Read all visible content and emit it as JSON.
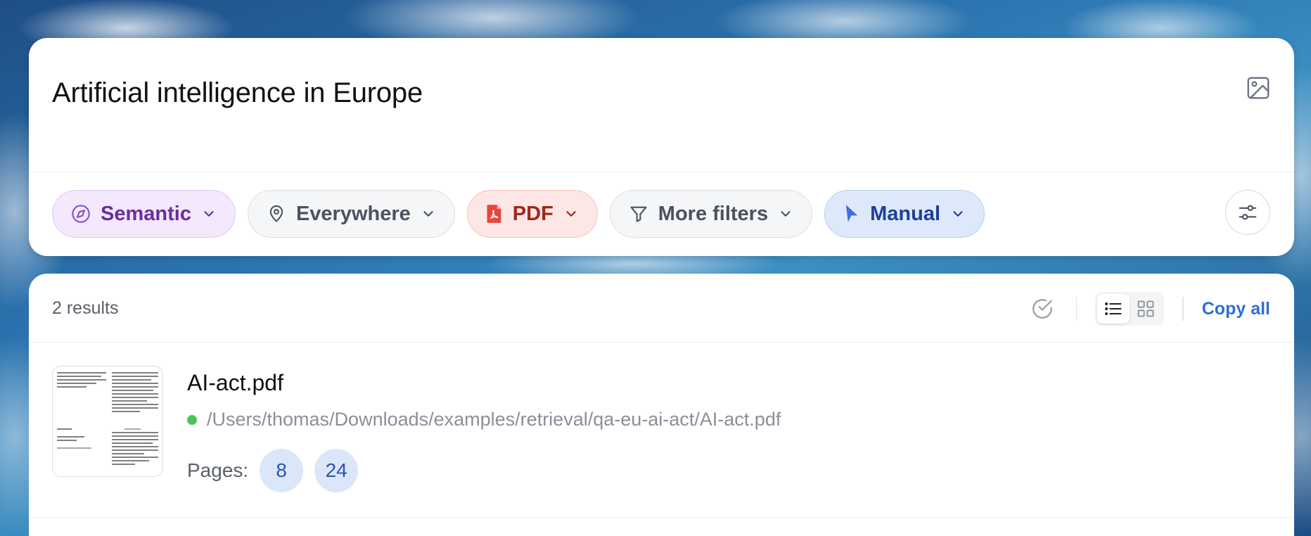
{
  "search": {
    "query": "Artificial intelligence in Europe",
    "image_button_icon": "image-icon"
  },
  "filters": {
    "semantic": {
      "label": "Semantic",
      "icon": "compass-icon",
      "color": "#6a2ca0"
    },
    "location": {
      "label": "Everywhere",
      "icon": "map-pin-icon",
      "color": "#4b5260"
    },
    "file_type": {
      "label": "PDF",
      "icon": "pdf-file-icon",
      "color": "#a0261b"
    },
    "more": {
      "label": "More filters",
      "icon": "filter-icon",
      "color": "#4b5260"
    },
    "mode": {
      "label": "Manual",
      "icon": "cursor-icon",
      "color": "#1e3f9a"
    },
    "settings_icon": "sliders-icon"
  },
  "results": {
    "count_text": "2 results",
    "copy_all_label": "Copy all",
    "view_mode": "list",
    "items": [
      {
        "title": "AI-act.pdf",
        "path": "/Users/thomas/Downloads/examples/retrieval/qa-eu-ai-act/AI-act.pdf",
        "status_color": "#4cc45a",
        "pages_label": "Pages:",
        "pages": [
          "8",
          "24"
        ]
      }
    ]
  },
  "colors": {
    "accent_blue": "#2f6fd6"
  }
}
